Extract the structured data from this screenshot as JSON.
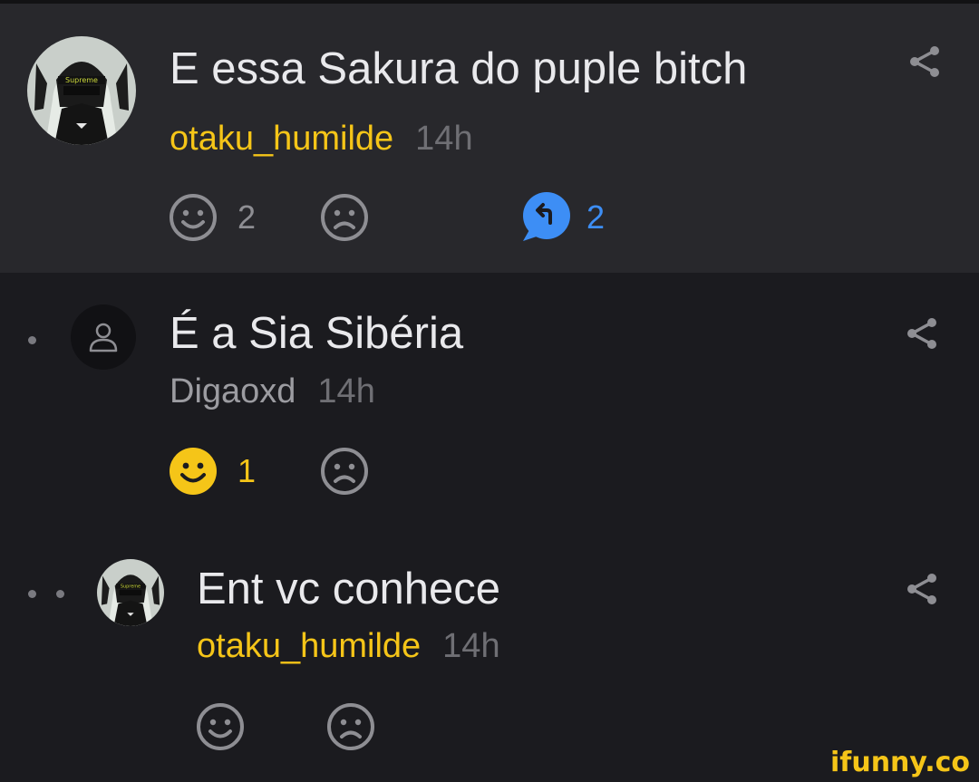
{
  "comments": [
    {
      "text": "E essa Sakura do puple bitch",
      "user": "otaku_humilde",
      "time": "14h",
      "likes": "2",
      "replies": "2",
      "avatar_icon": "anime-avatar",
      "avatar_badge": "Supreme"
    },
    {
      "text": "É a Sia Sibéria",
      "user": "Digaoxd",
      "time": "14h",
      "likes": "1",
      "avatar_icon": "person-icon"
    },
    {
      "text": "Ent vc conhece",
      "user": "otaku_humilde",
      "time": "14h",
      "avatar_icon": "anime-avatar",
      "avatar_badge": "Supreme"
    }
  ],
  "icons": {
    "smile": "smile-icon",
    "frown": "frown-icon",
    "share": "share-icon",
    "reply": "reply-bubble-icon"
  },
  "colors": {
    "gold": "#f5c518",
    "blue": "#3d8ef5",
    "panel_highlight": "#28282c",
    "background": "#1b1b1f"
  },
  "watermark": "ifunny.co"
}
